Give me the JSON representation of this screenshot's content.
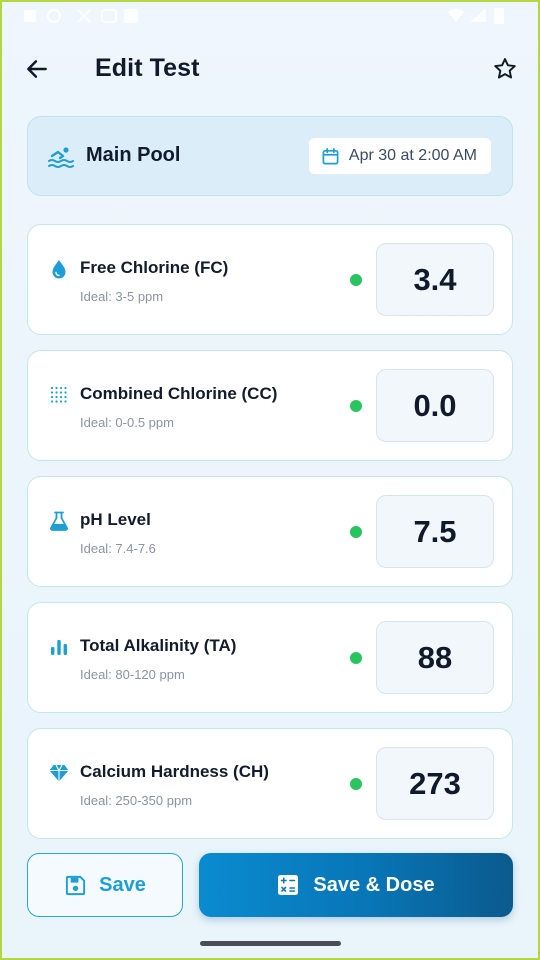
{
  "header": {
    "title": "Edit Test",
    "back_icon": "arrow-left-icon",
    "favorite_icon": "star-outline-icon"
  },
  "pool": {
    "name": "Main Pool",
    "icon": "swimmer-icon",
    "date": "Apr 30 at 2:00 AM",
    "date_icon": "calendar-icon"
  },
  "metrics": [
    {
      "name": "Free Chlorine (FC)",
      "ideal": "Ideal: 3-5 ppm",
      "value": "3.4",
      "status": "in-range",
      "icon": "water-drop-icon"
    },
    {
      "name": "Combined Chlorine (CC)",
      "ideal": "Ideal: 0-0.5 ppm",
      "value": "0.0",
      "status": "in-range",
      "icon": "dot-grid-icon"
    },
    {
      "name": "pH Level",
      "ideal": "Ideal: 7.4-7.6",
      "value": "7.5",
      "status": "in-range",
      "icon": "flask-icon"
    },
    {
      "name": "Total Alkalinity (TA)",
      "ideal": "Ideal: 80-120 ppm",
      "value": "88",
      "status": "in-range",
      "icon": "bar-chart-icon"
    },
    {
      "name": "Calcium Hardness (CH)",
      "ideal": "Ideal: 250-350 ppm",
      "value": "273",
      "status": "in-range",
      "icon": "diamond-icon"
    }
  ],
  "actions": {
    "save_label": "Save",
    "save_icon": "floppy-disk-icon",
    "save_dose_label": "Save & Dose",
    "save_dose_icon": "calculator-icon"
  },
  "colors": {
    "accent": "#1d9fd6",
    "primary_button": "#0875b6",
    "status_ok": "#28c45e",
    "card_border": "#c4e8e4"
  }
}
